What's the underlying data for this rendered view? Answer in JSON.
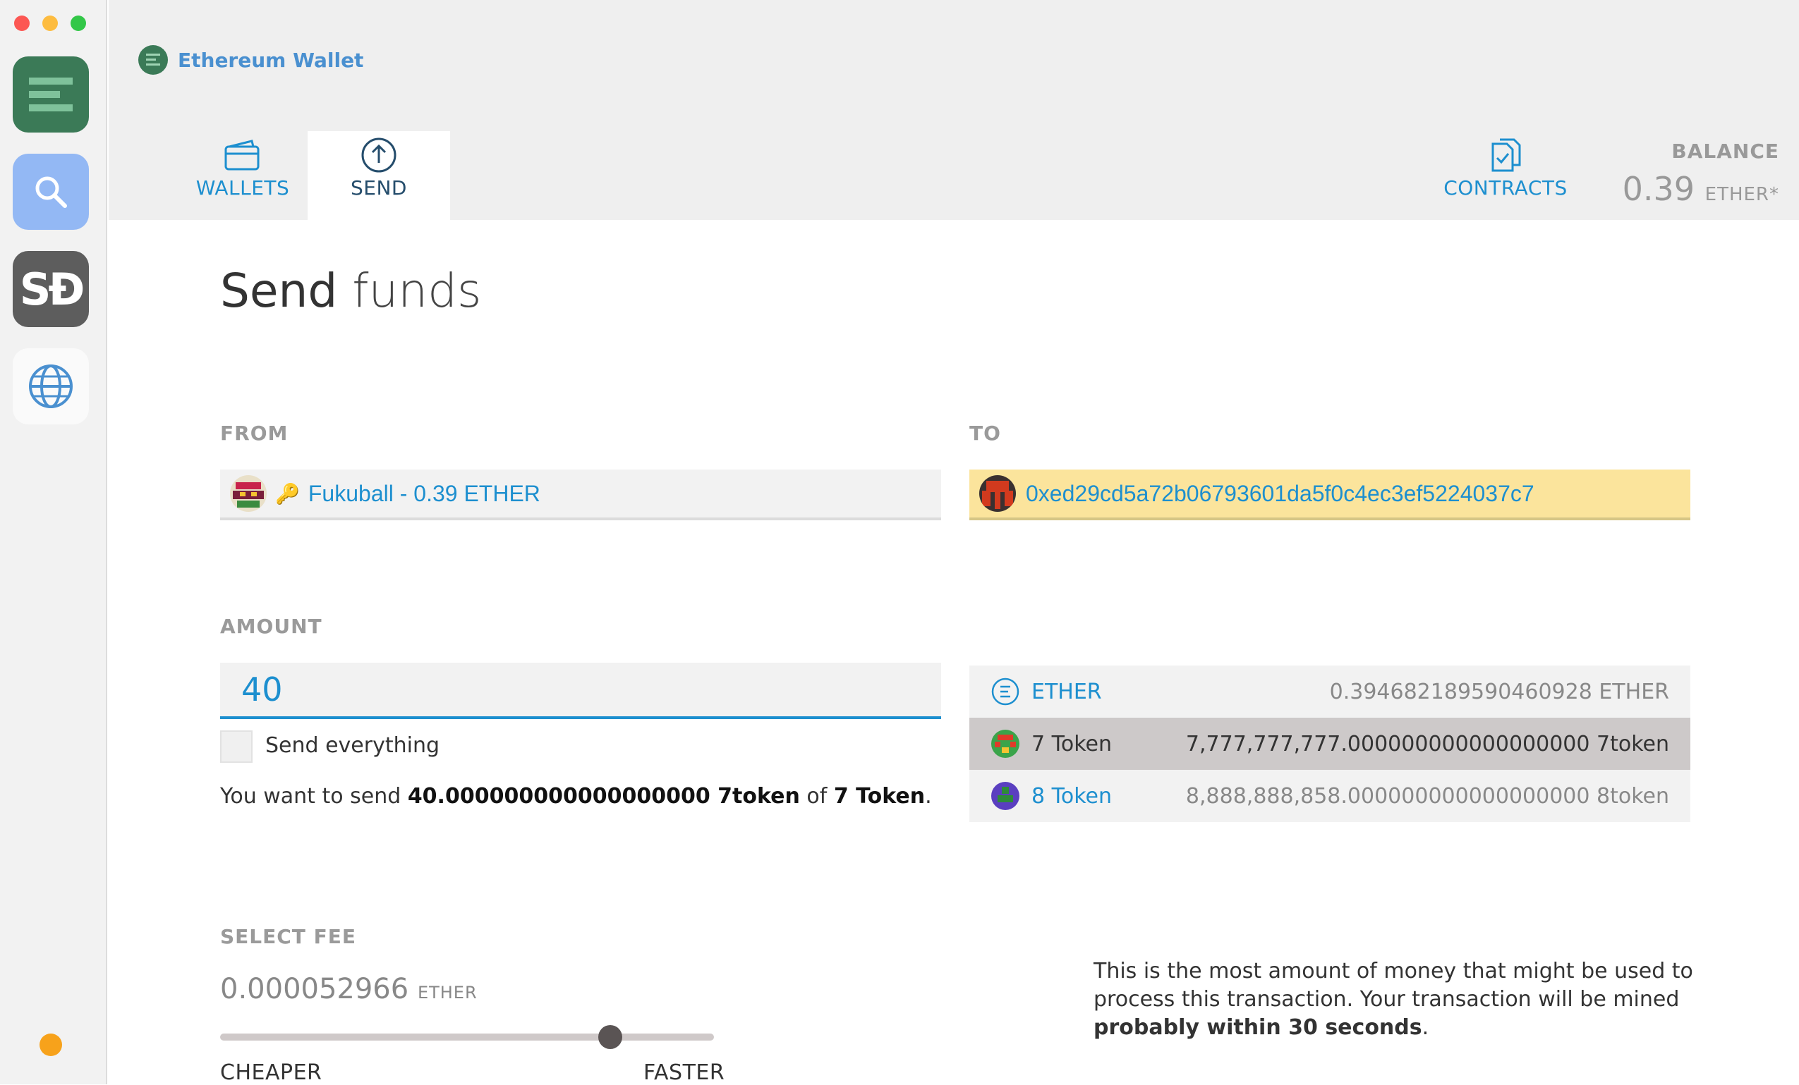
{
  "dock": {
    "apps": [
      {
        "name": "ethereum-wallet-app"
      },
      {
        "name": "search-app"
      },
      {
        "name": "sd-app",
        "label": "SĐ"
      },
      {
        "name": "browser-app"
      }
    ]
  },
  "header": {
    "app_title": "Ethereum Wallet",
    "tabs": {
      "wallets": "WALLETS",
      "send": "SEND",
      "contracts": "CONTRACTS"
    },
    "balance_label": "BALANCE",
    "balance_value": "0.39",
    "balance_unit": "ETHER*"
  },
  "page": {
    "title_bold": "Send",
    "title_light": "funds"
  },
  "from": {
    "label": "FROM",
    "account": "Fukuball - 0.39 ETHER"
  },
  "to": {
    "label": "TO",
    "address": "0xed29cd5a72b06793601da5f0c4ec3ef5224037c7"
  },
  "amount": {
    "label": "AMOUNT",
    "value": "40",
    "send_everything": "Send everything",
    "summary_prefix": "You want to send ",
    "summary_amount": "40.000000000000000000 7token",
    "summary_mid": " of ",
    "summary_token": "7 Token",
    "summary_end": "."
  },
  "tokens": [
    {
      "name": "ETHER",
      "balance": "0.394682189590460928 ETHER",
      "selected": false
    },
    {
      "name": "7 Token",
      "balance": "7,777,777,777.000000000000000000 7token",
      "selected": true
    },
    {
      "name": "8 Token",
      "balance": "8,888,888,858.000000000000000000 8token",
      "selected": false
    }
  ],
  "fee": {
    "label": "SELECT FEE",
    "value": "0.000052966",
    "unit": "ETHER",
    "slider_level": 0.79,
    "cheaper": "CHEAPER",
    "faster": "FASTER",
    "note_prefix": "This is the most amount of money that might be used to process this transaction. Your transaction will be mined ",
    "note_bold": "probably within 30 seconds",
    "note_end": "."
  },
  "colors": {
    "accent": "#1d8fcf",
    "header_bg": "#efefef",
    "to_highlight": "#fbe49c",
    "selected_row": "#cdc9c9"
  }
}
